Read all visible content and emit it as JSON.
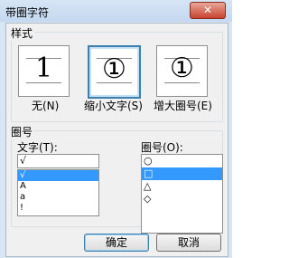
{
  "window": {
    "title": "带圈字符",
    "close_glyph": "✕"
  },
  "style_group": {
    "legend": "样式",
    "options": [
      {
        "glyph": "1",
        "label": "无(N)"
      },
      {
        "glyph": "①",
        "label": "缩小文字(S)"
      },
      {
        "glyph": "①",
        "label": "增大圈号(E)"
      }
    ],
    "selected_index": 1
  },
  "circle_group": {
    "legend": "圈号",
    "text_label": "文字(T):",
    "text_value": "√",
    "text_list": [
      "√",
      "A",
      "a",
      "!"
    ],
    "text_selected_index": 0,
    "circle_label": "圈号(O):",
    "circle_list": [
      "○",
      "□",
      "△",
      "◇"
    ],
    "circle_selected_index": 1
  },
  "buttons": {
    "ok": "确定",
    "cancel": "取消"
  }
}
